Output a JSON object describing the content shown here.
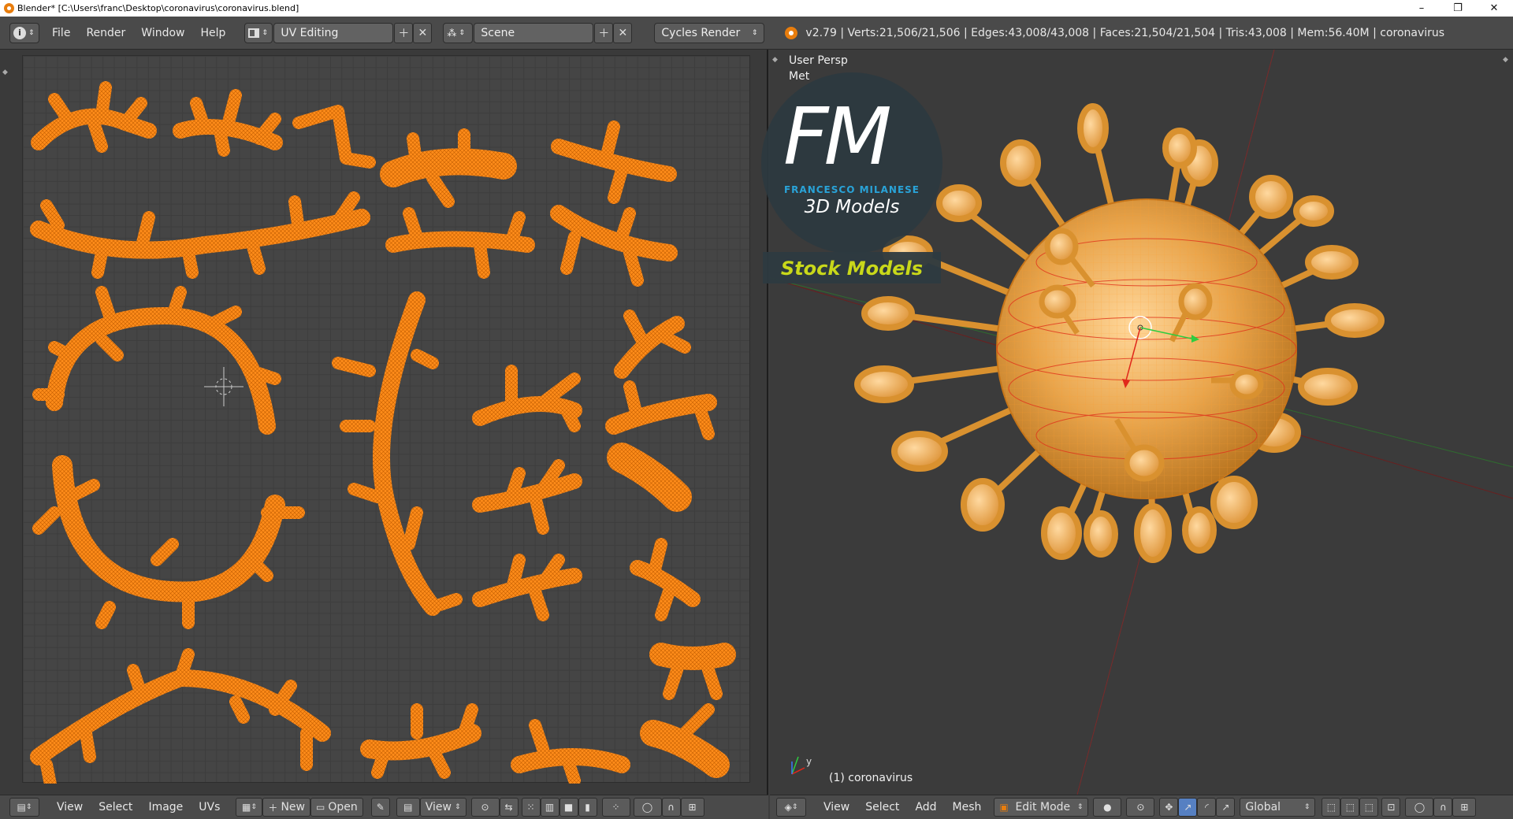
{
  "window": {
    "title": "Blender* [C:\\Users\\franc\\Desktop\\coronavirus\\coronavirus.blend]",
    "controls": {
      "minimize": "–",
      "maximize": "❐",
      "close": "✕"
    }
  },
  "infobar": {
    "menus": [
      "File",
      "Render",
      "Window",
      "Help"
    ],
    "layout": "UV Editing",
    "scene": "Scene",
    "engine": "Cycles Render",
    "stats": "v2.79 | Verts:21,506/21,506 | Edges:43,008/43,008 | Faces:21,504/21,504 | Tris:43,008 | Mem:56.40M | coronavirus"
  },
  "viewport": {
    "view_name": "User Persp",
    "units": "Met",
    "object_label": "(1) coronavirus",
    "axis_y": "y"
  },
  "watermark": {
    "logo_letters": "FM",
    "brand": "FRANCESCO MILANESE",
    "subtitle": "3D Models",
    "stock": "Stock Models"
  },
  "uv_header": {
    "menus": [
      "View",
      "Select",
      "Image",
      "UVs"
    ],
    "new_label": "New",
    "open_label": "Open",
    "view_label": "View"
  },
  "view3d_header": {
    "menus": [
      "View",
      "Select",
      "Add",
      "Mesh"
    ],
    "mode": "Edit Mode",
    "orientation": "Global"
  },
  "colors": {
    "uv_island": "#ff8c1a",
    "accent": "#e87d0d",
    "header_bg": "#4a4a4a"
  }
}
